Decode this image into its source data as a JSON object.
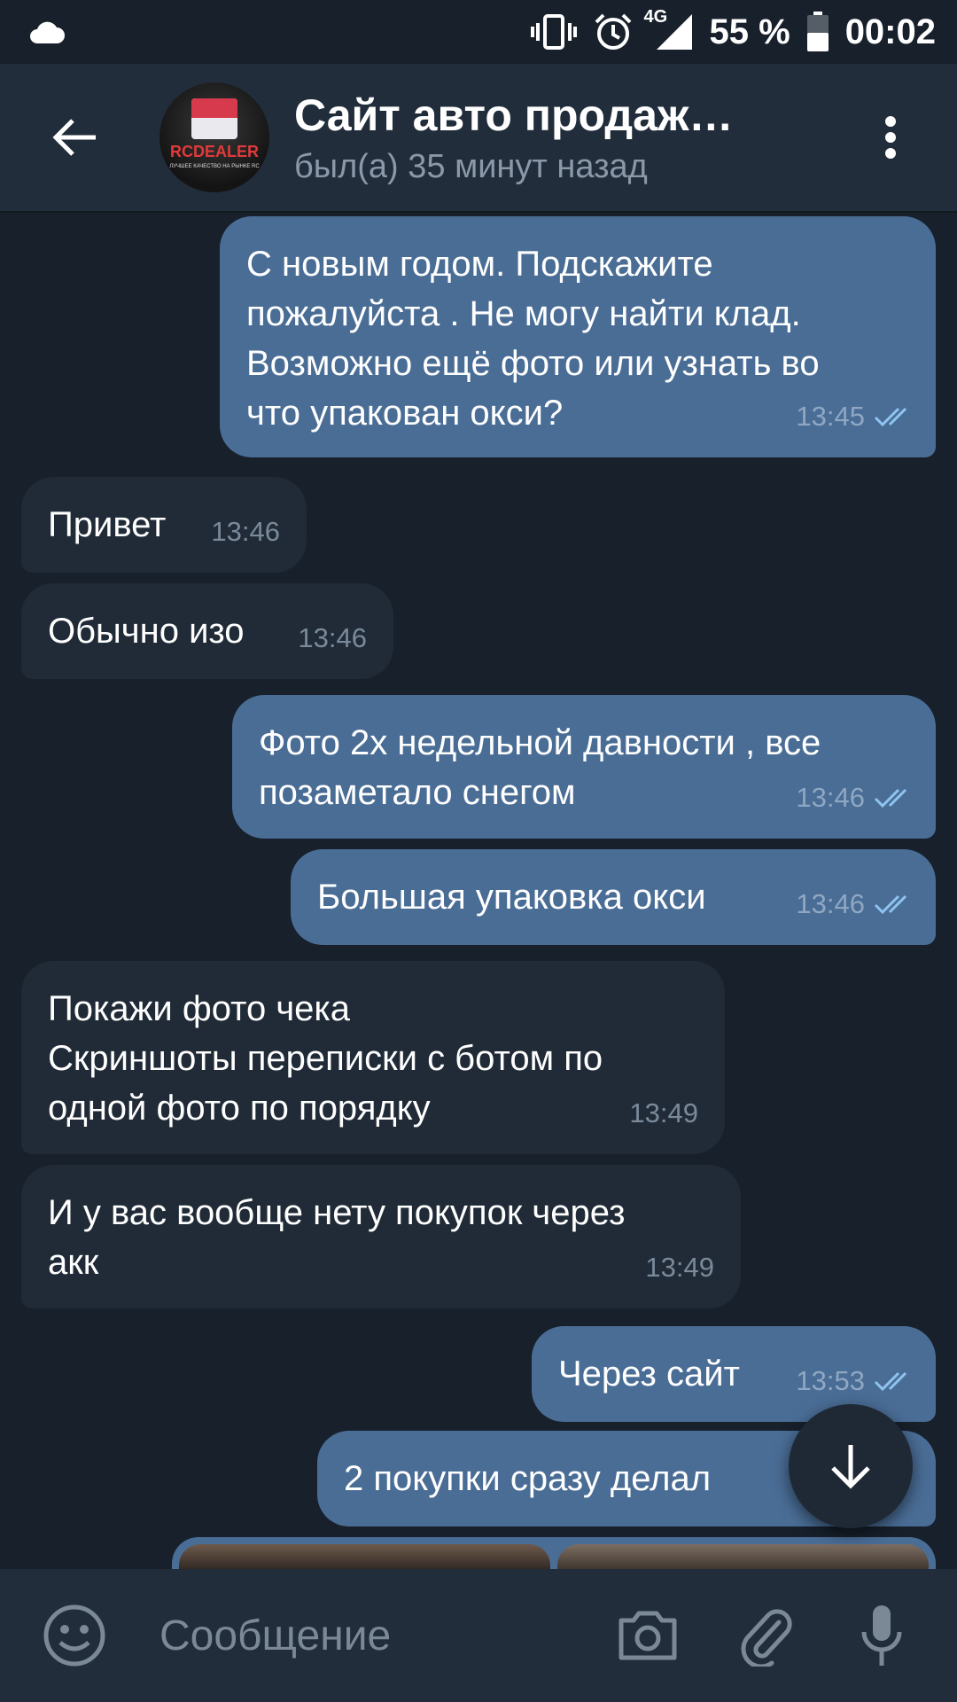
{
  "status_bar": {
    "battery": "55 %",
    "time": "00:02",
    "network": "4G",
    "icons": [
      "cloud-icon",
      "vibrate-icon",
      "alarm-icon",
      "signal-icon",
      "battery-icon"
    ]
  },
  "header": {
    "title": "Сайт авто продаж…",
    "status": "был(а) 35 минут назад",
    "avatar_logo": "RCDEALER",
    "avatar_tagline": "ЛУЧШЕЕ КАЧЕСТВО НА РЫНКЕ RC"
  },
  "messages": [
    {
      "dir": "out",
      "text": "С новым годом. Подскажите\nпожалуйста . Не могу найти клад.\nВозможно ещё фото или узнать во\nчто упакован окси?",
      "time": "13:45",
      "read": true
    },
    {
      "dir": "in",
      "text": "Привет",
      "time": "13:46"
    },
    {
      "dir": "in",
      "text": "Обычно изо",
      "time": "13:46"
    },
    {
      "dir": "out",
      "text": "Фото 2х недельной давности , все\nпозаметало снегом",
      "time": "13:46",
      "read": true
    },
    {
      "dir": "out",
      "text": "Большая упаковка окси",
      "time": "13:46",
      "read": true
    },
    {
      "dir": "in",
      "text": "Покажи фото чека\nСкриншоты переписки с ботом по\nодной фото по порядку",
      "time": "13:49"
    },
    {
      "dir": "in",
      "text": "И у вас вообще нету покупок через\nакк",
      "time": "13:49"
    },
    {
      "dir": "out",
      "text": "Через сайт",
      "time": "13:53",
      "read": true
    },
    {
      "dir": "out",
      "text": "2 покупки сразу делал",
      "time": "",
      "read": true
    }
  ],
  "input": {
    "placeholder": "Сообщение"
  },
  "colors": {
    "background": "#17202b",
    "header": "#212d3b",
    "outgoing_bubble": "#4a6d96",
    "incoming_bubble": "#202b37",
    "read_check": "#8fc3f0"
  }
}
